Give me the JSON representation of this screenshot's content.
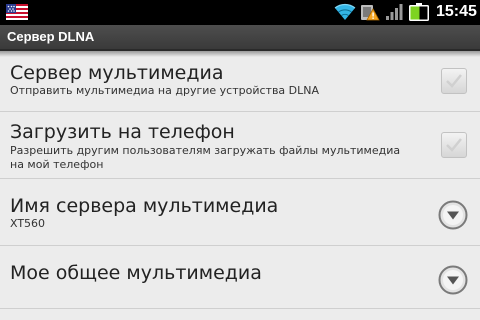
{
  "status_bar": {
    "time": "15:45",
    "icons": [
      "us-flag-icon",
      "wifi-icon",
      "alert-icon",
      "signal-icon",
      "battery-icon"
    ]
  },
  "title_bar": {
    "title": "Сервер DLNA"
  },
  "settings": [
    {
      "title": "Сервер мультимедиа",
      "subtitle": "Отправить мультимедиа на другие устройства DLNA",
      "control": "checkbox",
      "checked": true
    },
    {
      "title": "Загрузить на телефон",
      "subtitle": "Разрешить другим пользователям загружать файлы мультимедиа на мой телефон",
      "control": "checkbox",
      "checked": true
    },
    {
      "title": "Имя сервера мультимедиа",
      "subtitle": "XT560",
      "control": "expand"
    },
    {
      "title": "Мое общее мультимедиа",
      "control": "expand"
    }
  ],
  "colors": {
    "status_bar": "#000000",
    "title_bar": "#444444",
    "list_background": "#ececec",
    "wifi": "#33b5e5",
    "battery": "#7ed321"
  }
}
